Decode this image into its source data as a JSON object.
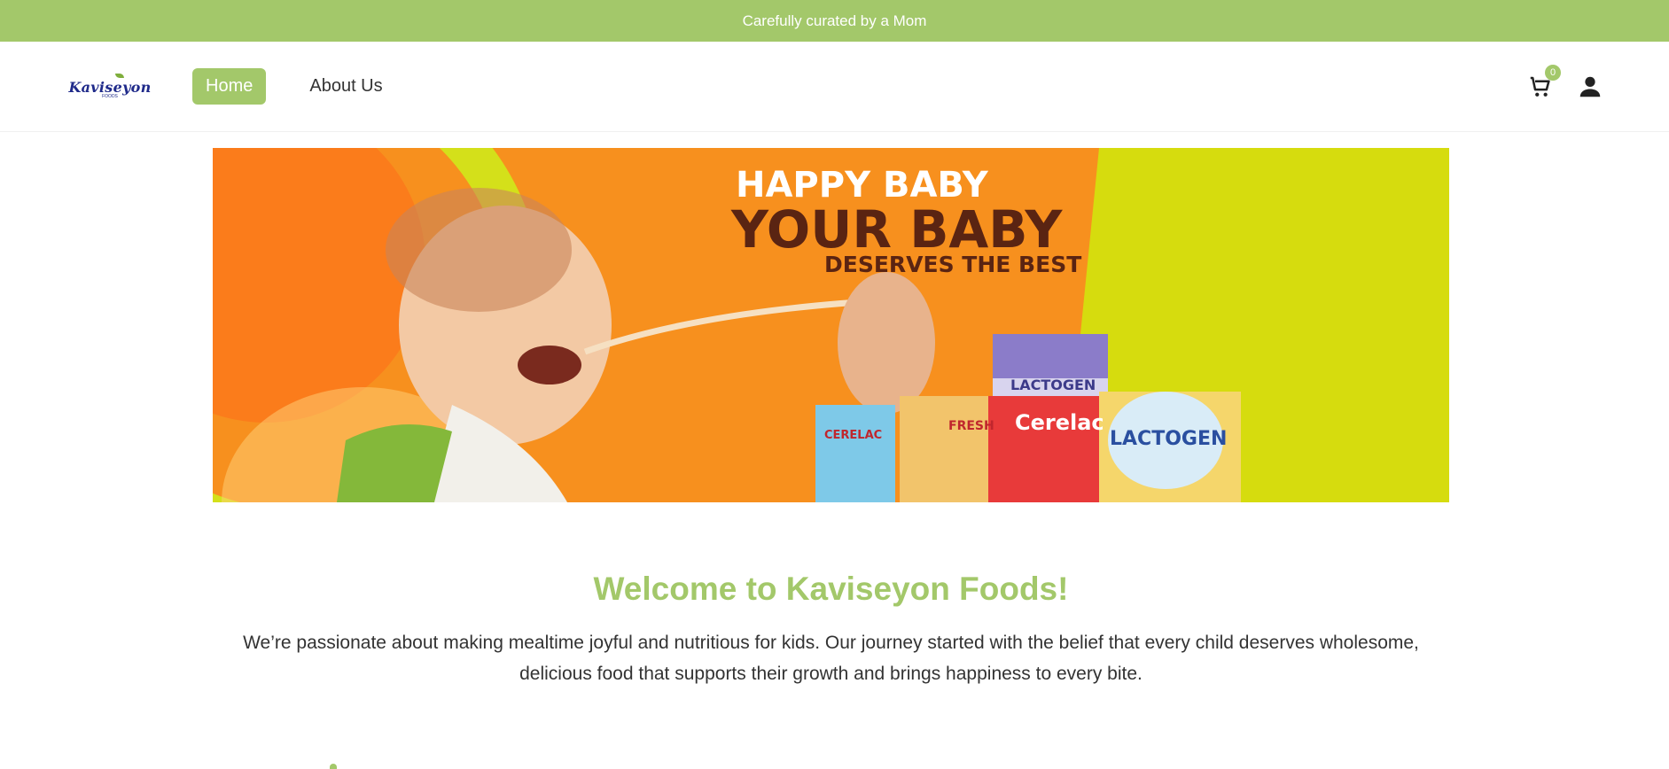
{
  "announcement": {
    "text": "Carefully curated by a Mom"
  },
  "header": {
    "logo": {
      "name": "Kaviseyon",
      "sub": "FOODS"
    },
    "nav": [
      {
        "label": "Home",
        "active": true
      },
      {
        "label": "About Us",
        "active": false
      }
    ],
    "cart_count": "0",
    "icons": [
      "cart-icon",
      "user-icon"
    ]
  },
  "banner": {
    "line1": "HAPPY BABY",
    "line2": "YOUR BABY",
    "line3": "DESERVES THE BEST",
    "products": [
      "CERELAC",
      "FRESH",
      "Cerelac",
      "LACTOGEN",
      "LACTOGEN"
    ]
  },
  "welcome": {
    "title": "Welcome to Kaviseyon Foods!",
    "text": "We’re passionate about making mealtime joyful and nutritious for kids. Our journey started with the belief that every child deserves wholesome, delicious food that supports their growth and brings happiness to every bite."
  },
  "colors": {
    "accent": "#a3c86a",
    "banner_bg": "#d6dc0e",
    "banner_orange": "#f7901e"
  }
}
